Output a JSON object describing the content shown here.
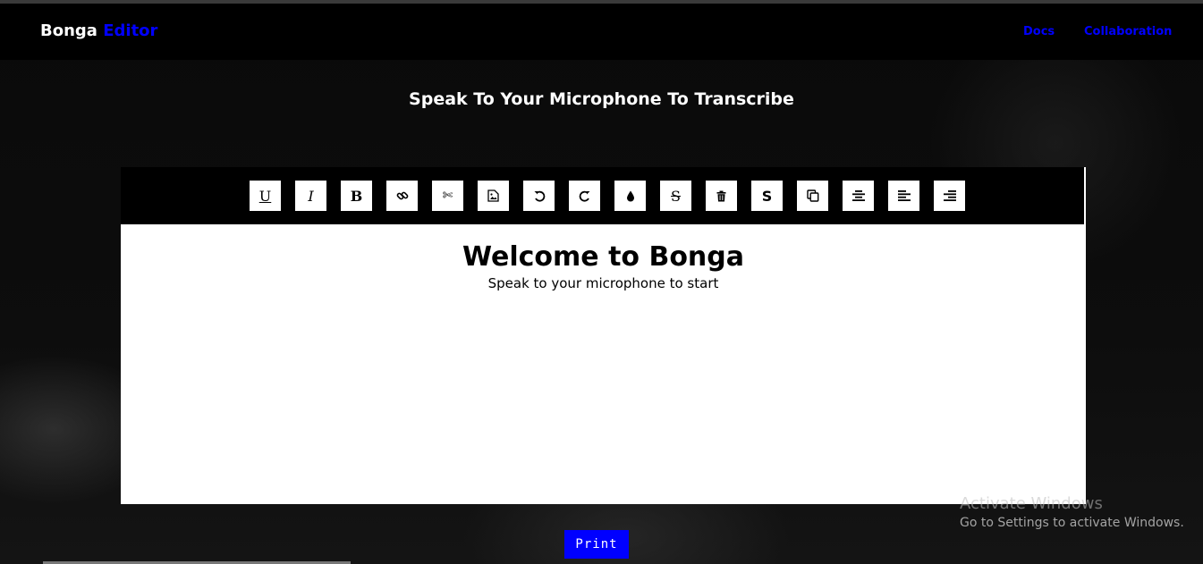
{
  "navbar": {
    "brand_first": "Bonga",
    "brand_second": "Editor",
    "links": [
      "Docs",
      "Collaboration"
    ]
  },
  "heading": "Speak To Your Microphone To Transcribe",
  "toolbar": {
    "tools": [
      {
        "name": "underline",
        "icon": "underline-icon",
        "glyph": "U"
      },
      {
        "name": "italic",
        "icon": "italic-icon",
        "glyph": "I"
      },
      {
        "name": "bold",
        "icon": "bold-icon",
        "glyph": "B"
      },
      {
        "name": "link",
        "icon": "link-icon"
      },
      {
        "name": "cut",
        "icon": "scissors-icon"
      },
      {
        "name": "image",
        "icon": "image-icon"
      },
      {
        "name": "undo",
        "icon": "undo-icon"
      },
      {
        "name": "redo",
        "icon": "redo-icon"
      },
      {
        "name": "color",
        "icon": "droplet-icon"
      },
      {
        "name": "strikethrough",
        "icon": "strikethrough-icon",
        "glyph": "S"
      },
      {
        "name": "delete",
        "icon": "trash-icon"
      },
      {
        "name": "spellcheck",
        "icon": "spellcheck-icon",
        "glyph": "S"
      },
      {
        "name": "copy",
        "icon": "copy-icon"
      },
      {
        "name": "align-center",
        "icon": "align-center-icon"
      },
      {
        "name": "align-left",
        "icon": "align-left-icon"
      },
      {
        "name": "align-right",
        "icon": "align-right-icon"
      }
    ]
  },
  "editor": {
    "title": "Welcome to Bonga",
    "subtitle": "Speak to your microphone to start"
  },
  "print_label": "Print",
  "watermark": {
    "line1": "Activate Windows",
    "line2": "Go to Settings to activate Windows."
  },
  "colors": {
    "accent": "#0000ff",
    "background": "#000000",
    "editor": "#ffffff"
  }
}
